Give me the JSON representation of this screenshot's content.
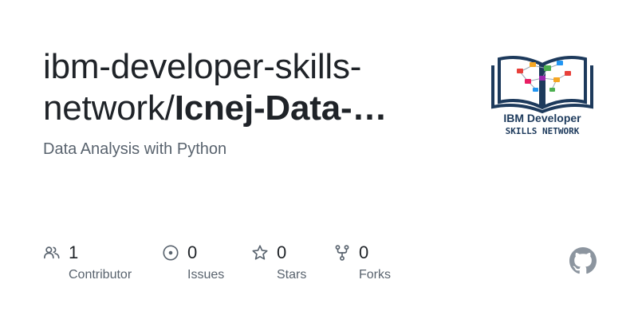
{
  "card": {
    "owner_line": "ibm-developer-skills-",
    "owner_cont": "network/",
    "repo_name": "Icnej-Data-…",
    "description": "Data Analysis with Python"
  },
  "logo": {
    "line1": "IBM Developer",
    "line2": "SKILLS NETWORK",
    "colors": {
      "book": "#1d3a5c",
      "nodes": [
        "#e8403a",
        "#f5a623",
        "#4caf50",
        "#2196f3",
        "#e91e63",
        "#9c27b0"
      ]
    }
  },
  "stats": [
    {
      "count": "1",
      "label": "Contributor",
      "icon": "people-icon"
    },
    {
      "count": "0",
      "label": "Issues",
      "icon": "issue-icon"
    },
    {
      "count": "0",
      "label": "Stars",
      "icon": "star-icon"
    },
    {
      "count": "0",
      "label": "Forks",
      "icon": "fork-icon"
    }
  ],
  "brand_icon": "github-icon",
  "colors": {
    "text": "#1f2328",
    "muted": "#59636e",
    "icon": "#59636e"
  }
}
